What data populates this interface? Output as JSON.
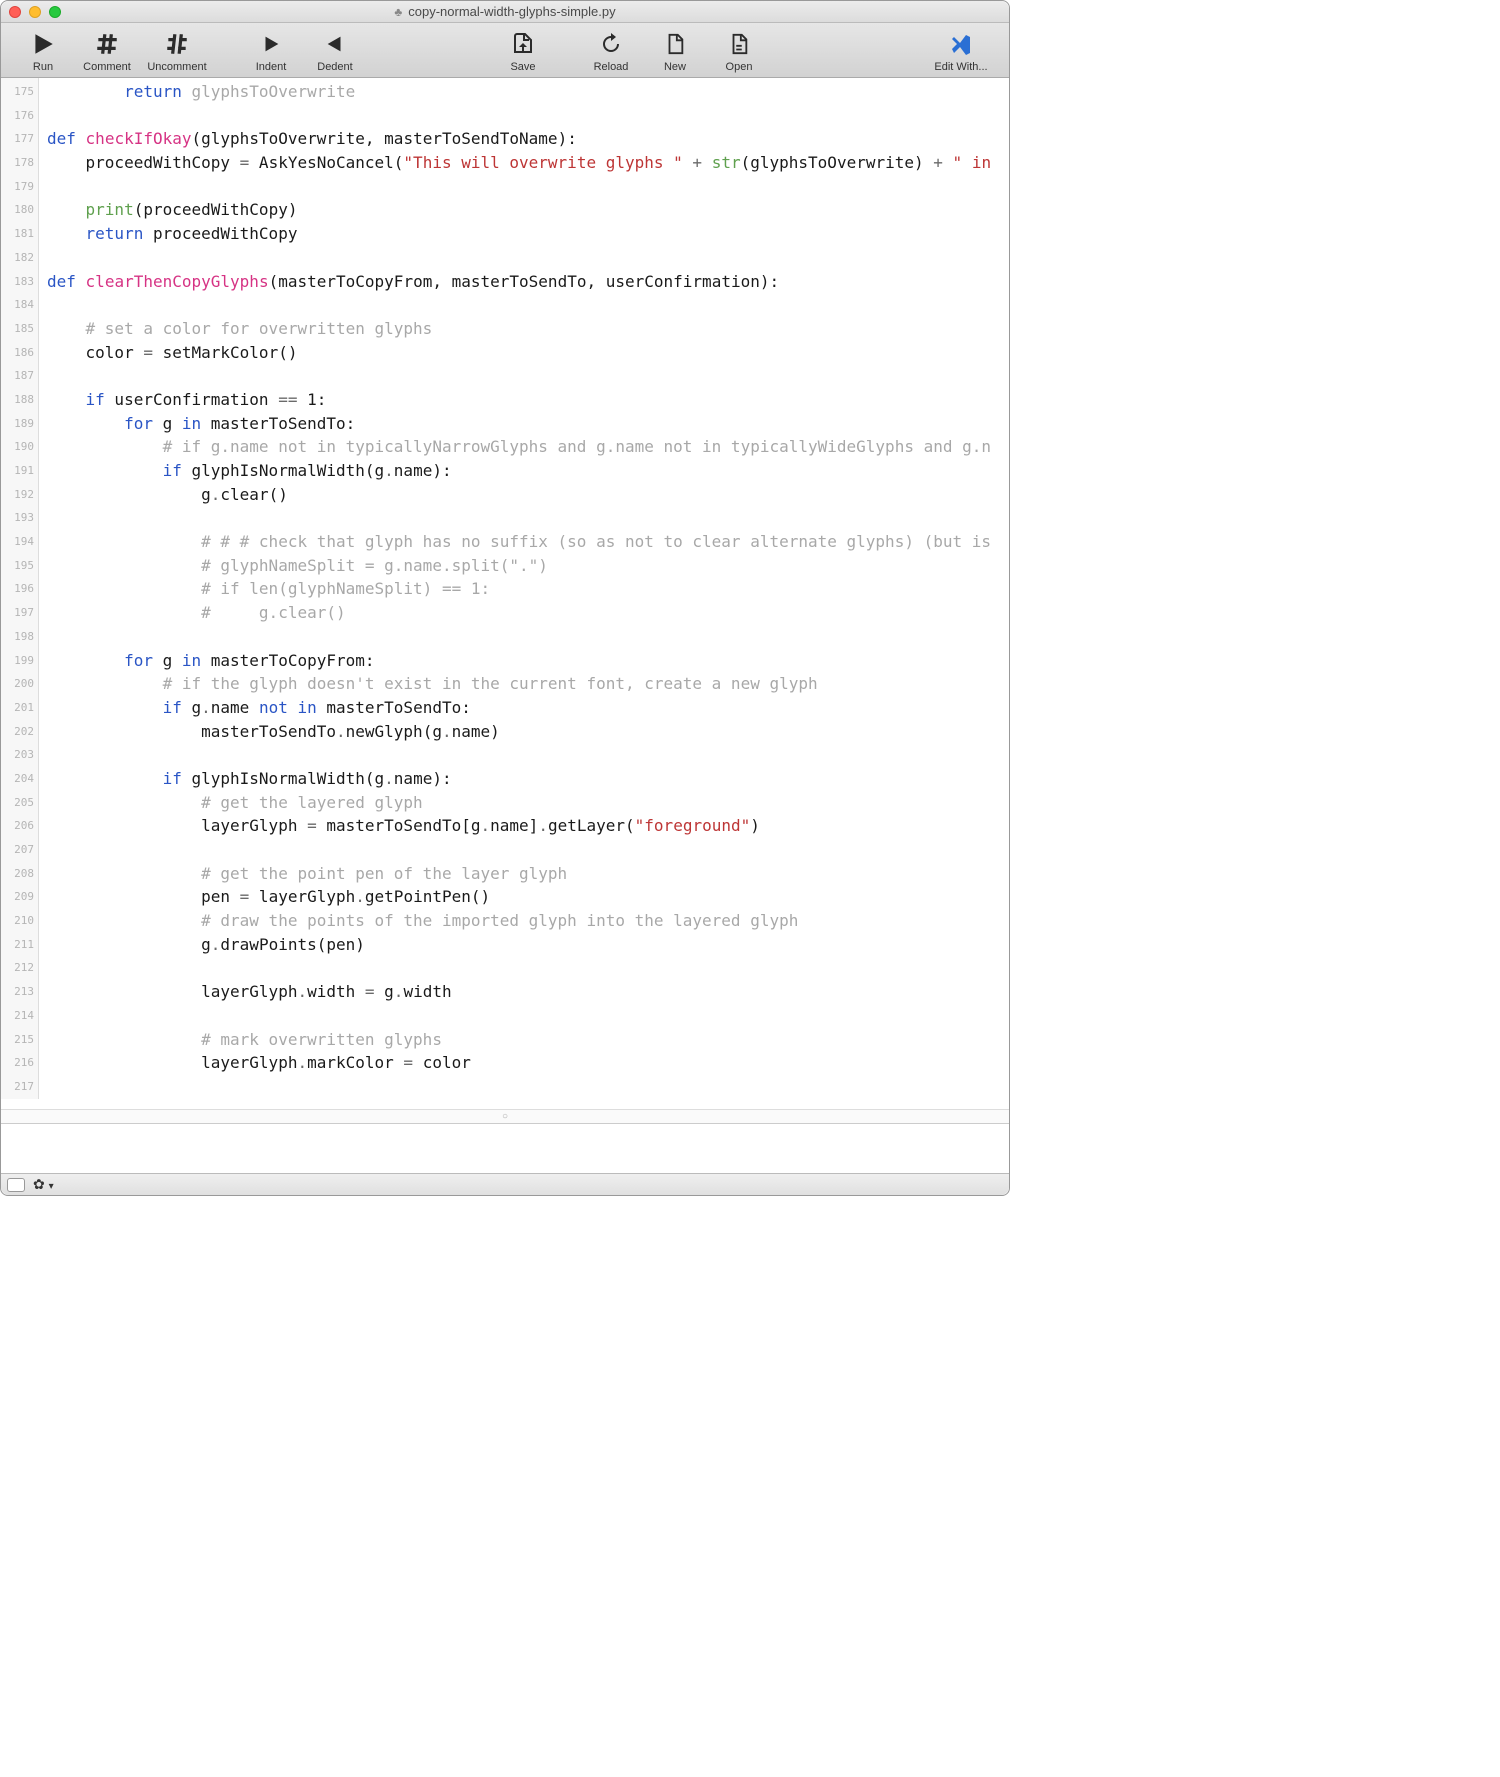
{
  "window": {
    "title": "copy-normal-width-glyphs-simple.py",
    "title_icon": "♣"
  },
  "toolbar": {
    "run": "Run",
    "comment": "Comment",
    "uncomment": "Uncomment",
    "indent": "Indent",
    "dedent": "Dedent",
    "save": "Save",
    "reload": "Reload",
    "new": "New",
    "open": "Open",
    "edit_with": "Edit With..."
  },
  "gutter": {
    "start": 175,
    "end": 217
  },
  "code": {
    "lines": [
      {
        "n": 175,
        "seg": [
          {
            "t": "        ",
            "c": ""
          },
          {
            "t": "return",
            "c": "kw"
          },
          {
            "t": " glyphsToOverwrite",
            "c": "gray"
          }
        ]
      },
      {
        "n": 176,
        "seg": [
          {
            "t": "",
            "c": ""
          }
        ]
      },
      {
        "n": 177,
        "seg": [
          {
            "t": "def",
            "c": "kw"
          },
          {
            "t": " ",
            "c": ""
          },
          {
            "t": "checkIfOkay",
            "c": "fn"
          },
          {
            "t": "(glyphsToOverwrite, masterToSendToName):",
            "c": ""
          }
        ]
      },
      {
        "n": 178,
        "seg": [
          {
            "t": "    proceedWithCopy ",
            "c": ""
          },
          {
            "t": "=",
            "c": "op"
          },
          {
            "t": " AskYesNoCancel(",
            "c": ""
          },
          {
            "t": "\"This will overwrite glyphs \"",
            "c": "st"
          },
          {
            "t": " ",
            "c": ""
          },
          {
            "t": "+",
            "c": "op"
          },
          {
            "t": " ",
            "c": ""
          },
          {
            "t": "str",
            "c": "gr"
          },
          {
            "t": "(glyphsToOverwrite) ",
            "c": ""
          },
          {
            "t": "+",
            "c": "op"
          },
          {
            "t": " ",
            "c": ""
          },
          {
            "t": "\" in",
            "c": "st"
          }
        ]
      },
      {
        "n": 179,
        "seg": [
          {
            "t": "",
            "c": ""
          }
        ]
      },
      {
        "n": 180,
        "seg": [
          {
            "t": "    ",
            "c": ""
          },
          {
            "t": "print",
            "c": "gr"
          },
          {
            "t": "(proceedWithCopy)",
            "c": ""
          }
        ]
      },
      {
        "n": 181,
        "seg": [
          {
            "t": "    ",
            "c": ""
          },
          {
            "t": "return",
            "c": "kw"
          },
          {
            "t": " proceedWithCopy",
            "c": ""
          }
        ]
      },
      {
        "n": 182,
        "seg": [
          {
            "t": "",
            "c": ""
          }
        ]
      },
      {
        "n": 183,
        "seg": [
          {
            "t": "def",
            "c": "kw"
          },
          {
            "t": " ",
            "c": ""
          },
          {
            "t": "clearThenCopyGlyphs",
            "c": "fn"
          },
          {
            "t": "(masterToCopyFrom, masterToSendTo, userConfirmation):",
            "c": ""
          }
        ]
      },
      {
        "n": 184,
        "seg": [
          {
            "t": "",
            "c": ""
          }
        ]
      },
      {
        "n": 185,
        "seg": [
          {
            "t": "    ",
            "c": ""
          },
          {
            "t": "# set a color for overwritten glyphs",
            "c": "cm"
          }
        ]
      },
      {
        "n": 186,
        "seg": [
          {
            "t": "    color ",
            "c": ""
          },
          {
            "t": "=",
            "c": "op"
          },
          {
            "t": " setMarkColor()",
            "c": ""
          }
        ]
      },
      {
        "n": 187,
        "seg": [
          {
            "t": "",
            "c": ""
          }
        ]
      },
      {
        "n": 188,
        "seg": [
          {
            "t": "    ",
            "c": ""
          },
          {
            "t": "if",
            "c": "kw"
          },
          {
            "t": " userConfirmation ",
            "c": ""
          },
          {
            "t": "==",
            "c": "op"
          },
          {
            "t": " ",
            "c": ""
          },
          {
            "t": "1",
            "c": ""
          },
          {
            "t": ":",
            "c": ""
          }
        ]
      },
      {
        "n": 189,
        "seg": [
          {
            "t": "        ",
            "c": ""
          },
          {
            "t": "for",
            "c": "kw"
          },
          {
            "t": " g ",
            "c": ""
          },
          {
            "t": "in",
            "c": "kw"
          },
          {
            "t": " masterToSendTo:",
            "c": ""
          }
        ]
      },
      {
        "n": 190,
        "seg": [
          {
            "t": "            ",
            "c": ""
          },
          {
            "t": "# if g.name not in typicallyNarrowGlyphs and g.name not in typicallyWideGlyphs and g.n",
            "c": "cm"
          }
        ]
      },
      {
        "n": 191,
        "seg": [
          {
            "t": "            ",
            "c": ""
          },
          {
            "t": "if",
            "c": "kw"
          },
          {
            "t": " glyphIsNormalWidth(g",
            "c": ""
          },
          {
            "t": ".",
            "c": "op"
          },
          {
            "t": "name):",
            "c": ""
          }
        ]
      },
      {
        "n": 192,
        "seg": [
          {
            "t": "                g",
            "c": ""
          },
          {
            "t": ".",
            "c": "op"
          },
          {
            "t": "clear()",
            "c": ""
          }
        ]
      },
      {
        "n": 193,
        "seg": [
          {
            "t": "",
            "c": ""
          }
        ]
      },
      {
        "n": 194,
        "seg": [
          {
            "t": "                ",
            "c": ""
          },
          {
            "t": "# # # check that glyph has no suffix (so as not to clear alternate glyphs) (but is",
            "c": "cm"
          }
        ]
      },
      {
        "n": 195,
        "seg": [
          {
            "t": "                ",
            "c": ""
          },
          {
            "t": "# glyphNameSplit = g.name.split(\".\")",
            "c": "cm"
          }
        ]
      },
      {
        "n": 196,
        "seg": [
          {
            "t": "                ",
            "c": ""
          },
          {
            "t": "# if len(glyphNameSplit) == 1:",
            "c": "cm"
          }
        ]
      },
      {
        "n": 197,
        "seg": [
          {
            "t": "                ",
            "c": ""
          },
          {
            "t": "#     g.clear()",
            "c": "cm"
          }
        ]
      },
      {
        "n": 198,
        "seg": [
          {
            "t": "",
            "c": ""
          }
        ]
      },
      {
        "n": 199,
        "seg": [
          {
            "t": "        ",
            "c": ""
          },
          {
            "t": "for",
            "c": "kw"
          },
          {
            "t": " g ",
            "c": ""
          },
          {
            "t": "in",
            "c": "kw"
          },
          {
            "t": " masterToCopyFrom:",
            "c": ""
          }
        ]
      },
      {
        "n": 200,
        "seg": [
          {
            "t": "            ",
            "c": ""
          },
          {
            "t": "# if the glyph doesn't exist in the current font, create a new glyph",
            "c": "cm"
          }
        ]
      },
      {
        "n": 201,
        "seg": [
          {
            "t": "            ",
            "c": ""
          },
          {
            "t": "if",
            "c": "kw"
          },
          {
            "t": " g",
            "c": ""
          },
          {
            "t": ".",
            "c": "op"
          },
          {
            "t": "name ",
            "c": ""
          },
          {
            "t": "not in",
            "c": "kw"
          },
          {
            "t": " masterToSendTo:",
            "c": ""
          }
        ]
      },
      {
        "n": 202,
        "seg": [
          {
            "t": "                masterToSendTo",
            "c": ""
          },
          {
            "t": ".",
            "c": "op"
          },
          {
            "t": "newGlyph(g",
            "c": ""
          },
          {
            "t": ".",
            "c": "op"
          },
          {
            "t": "name)",
            "c": ""
          }
        ]
      },
      {
        "n": 203,
        "seg": [
          {
            "t": "",
            "c": ""
          }
        ]
      },
      {
        "n": 204,
        "seg": [
          {
            "t": "            ",
            "c": ""
          },
          {
            "t": "if",
            "c": "kw"
          },
          {
            "t": " glyphIsNormalWidth(g",
            "c": ""
          },
          {
            "t": ".",
            "c": "op"
          },
          {
            "t": "name):",
            "c": ""
          }
        ]
      },
      {
        "n": 205,
        "seg": [
          {
            "t": "                ",
            "c": ""
          },
          {
            "t": "# get the layered glyph",
            "c": "cm"
          }
        ]
      },
      {
        "n": 206,
        "seg": [
          {
            "t": "                layerGlyph ",
            "c": ""
          },
          {
            "t": "=",
            "c": "op"
          },
          {
            "t": " masterToSendTo[g",
            "c": ""
          },
          {
            "t": ".",
            "c": "op"
          },
          {
            "t": "name]",
            "c": ""
          },
          {
            "t": ".",
            "c": "op"
          },
          {
            "t": "getLayer(",
            "c": ""
          },
          {
            "t": "\"foreground\"",
            "c": "st"
          },
          {
            "t": ")",
            "c": ""
          }
        ]
      },
      {
        "n": 207,
        "seg": [
          {
            "t": "",
            "c": ""
          }
        ]
      },
      {
        "n": 208,
        "seg": [
          {
            "t": "                ",
            "c": ""
          },
          {
            "t": "# get the point pen of the layer glyph",
            "c": "cm"
          }
        ]
      },
      {
        "n": 209,
        "seg": [
          {
            "t": "                pen ",
            "c": ""
          },
          {
            "t": "=",
            "c": "op"
          },
          {
            "t": " layerGlyph",
            "c": ""
          },
          {
            "t": ".",
            "c": "op"
          },
          {
            "t": "getPointPen()",
            "c": ""
          }
        ]
      },
      {
        "n": 210,
        "seg": [
          {
            "t": "                ",
            "c": ""
          },
          {
            "t": "# draw the points of the imported glyph into the layered glyph",
            "c": "cm"
          }
        ]
      },
      {
        "n": 211,
        "seg": [
          {
            "t": "                g",
            "c": ""
          },
          {
            "t": ".",
            "c": "op"
          },
          {
            "t": "drawPoints(pen)",
            "c": ""
          }
        ]
      },
      {
        "n": 212,
        "seg": [
          {
            "t": "",
            "c": ""
          }
        ]
      },
      {
        "n": 213,
        "seg": [
          {
            "t": "                layerGlyph",
            "c": ""
          },
          {
            "t": ".",
            "c": "op"
          },
          {
            "t": "width ",
            "c": ""
          },
          {
            "t": "=",
            "c": "op"
          },
          {
            "t": " g",
            "c": ""
          },
          {
            "t": ".",
            "c": "op"
          },
          {
            "t": "width",
            "c": ""
          }
        ]
      },
      {
        "n": 214,
        "seg": [
          {
            "t": "",
            "c": ""
          }
        ]
      },
      {
        "n": 215,
        "seg": [
          {
            "t": "                ",
            "c": ""
          },
          {
            "t": "# mark overwritten glyphs",
            "c": "cm"
          }
        ]
      },
      {
        "n": 216,
        "seg": [
          {
            "t": "                layerGlyph",
            "c": ""
          },
          {
            "t": ".",
            "c": "op"
          },
          {
            "t": "markColor ",
            "c": ""
          },
          {
            "t": "=",
            "c": "op"
          },
          {
            "t": " color",
            "c": ""
          }
        ]
      },
      {
        "n": 217,
        "seg": [
          {
            "t": "",
            "c": ""
          }
        ]
      }
    ]
  }
}
